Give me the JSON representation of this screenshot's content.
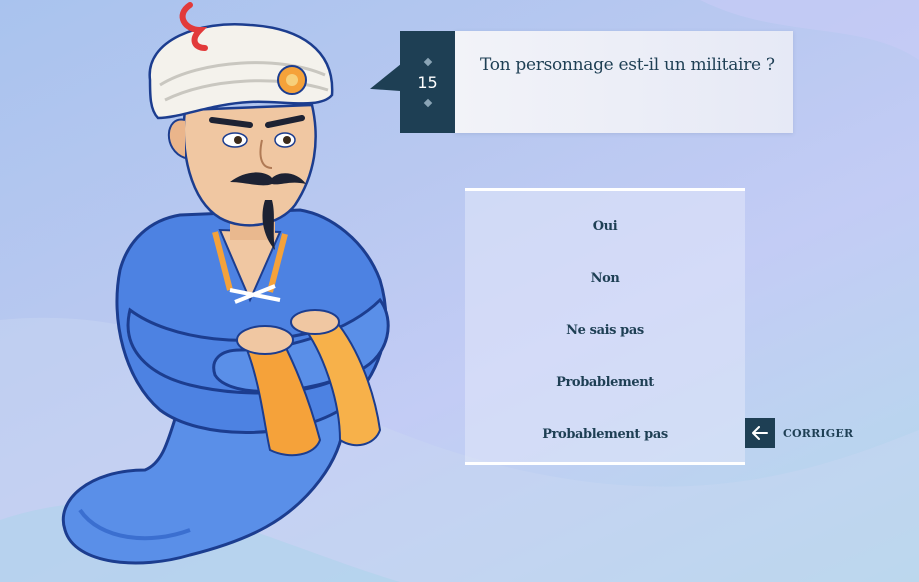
{
  "question": {
    "number": "15",
    "text": "Ton personnage est-il un militaire ?"
  },
  "answers": [
    {
      "label": "Oui"
    },
    {
      "label": "Non"
    },
    {
      "label": "Ne sais pas"
    },
    {
      "label": "Probablement"
    },
    {
      "label": "Probablement pas"
    }
  ],
  "corriger": {
    "label": "CORRIGER",
    "icon": "arrow-left-icon"
  },
  "genie": {
    "icon": "akinator-genie-illustration"
  },
  "colors": {
    "primary": "#1e3f54",
    "background": "#b8c8f0",
    "genie_robe": "#4a7de0",
    "turban": "#f4f2ec",
    "sleeves": "#f5a23a"
  }
}
